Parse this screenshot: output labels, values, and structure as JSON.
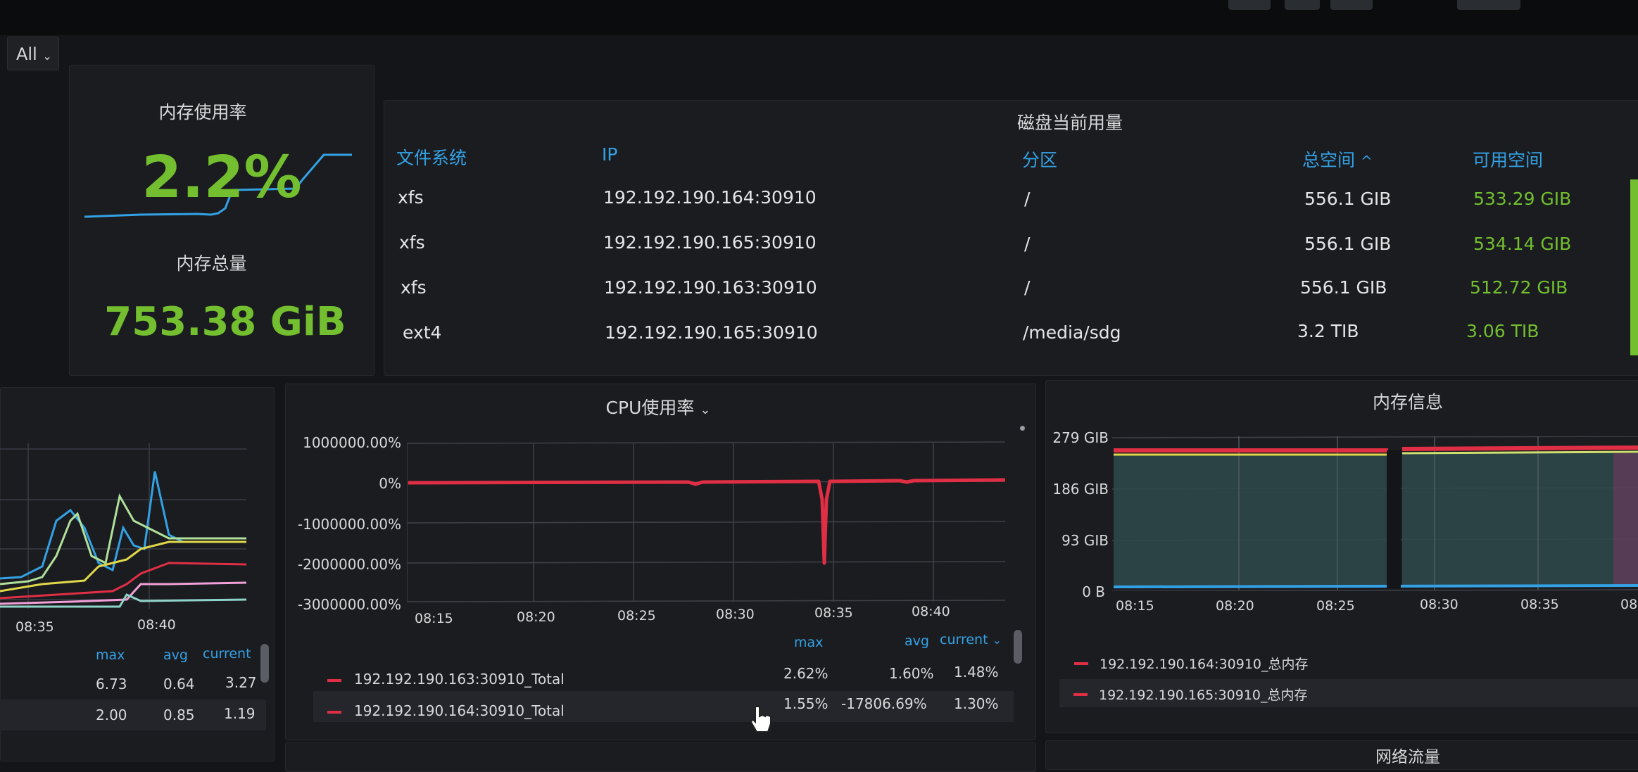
{
  "variables": {
    "all_label": "All"
  },
  "memory_usage": {
    "title": "内存使用率",
    "value": "2.2%"
  },
  "memory_total": {
    "title": "内存总量",
    "value": "753.38 GiB"
  },
  "disk": {
    "title": "磁盘当前用量",
    "columns": [
      "文件系统",
      "IP",
      "分区",
      "总空间",
      "可用空间"
    ],
    "sort_indicator": "^",
    "rows": [
      [
        "xfs",
        "192.192.190.164:30910",
        "/",
        "556.1 GIB",
        "533.29 GIB"
      ],
      [
        "xfs",
        "192.192.190.165:30910",
        "/",
        "556.1 GIB",
        "534.14 GIB"
      ],
      [
        "xfs",
        "192.192.190.163:30910",
        "/",
        "556.1 GIB",
        "512.72 GIB"
      ],
      [
        "ext4",
        "192.192.190.165:30910",
        "/media/sdg",
        "3.2 TIB",
        "3.06 TIB"
      ]
    ]
  },
  "left_chart": {
    "x_ticks": [
      "08:35",
      "08:40"
    ],
    "legend_headers": [
      "max",
      "avg",
      "current"
    ],
    "rows": [
      [
        "6.73",
        "0.64",
        "3.27"
      ],
      [
        "2.00",
        "0.85",
        "1.19"
      ]
    ]
  },
  "cpu": {
    "title": "CPU使用率",
    "y_ticks": [
      "1000000.00%",
      "0%",
      "-1000000.00%",
      "-2000000.00%",
      "-3000000.00%"
    ],
    "x_ticks": [
      "08:15",
      "08:20",
      "08:25",
      "08:30",
      "08:35",
      "08:40"
    ],
    "legend_headers": [
      "max",
      "avg",
      "current"
    ],
    "series": [
      {
        "name": "192.192.190.163:30910_Total",
        "max": "2.62%",
        "avg": "1.60%",
        "current": "1.48%"
      },
      {
        "name": "192.192.190.164:30910_Total",
        "max": "1.55%",
        "avg": "-17806.69%",
        "current": "1.30%"
      }
    ]
  },
  "mem_info": {
    "title": "内存信息",
    "y_ticks": [
      "279 GIB",
      "186 GIB",
      "93 GIB",
      "0 B"
    ],
    "x_ticks": [
      "08:15",
      "08:20",
      "08:25",
      "08:30",
      "08:35",
      "08:"
    ],
    "series": [
      {
        "name": "192.192.190.164:30910_总内存"
      },
      {
        "name": "192.192.190.165:30910_总内存"
      }
    ]
  },
  "network": {
    "title": "网络流量"
  },
  "colors": {
    "green": "#73bf2f",
    "blue": "#33a2e5",
    "red": "#e02f44",
    "yellow": "#e0d84a"
  }
}
